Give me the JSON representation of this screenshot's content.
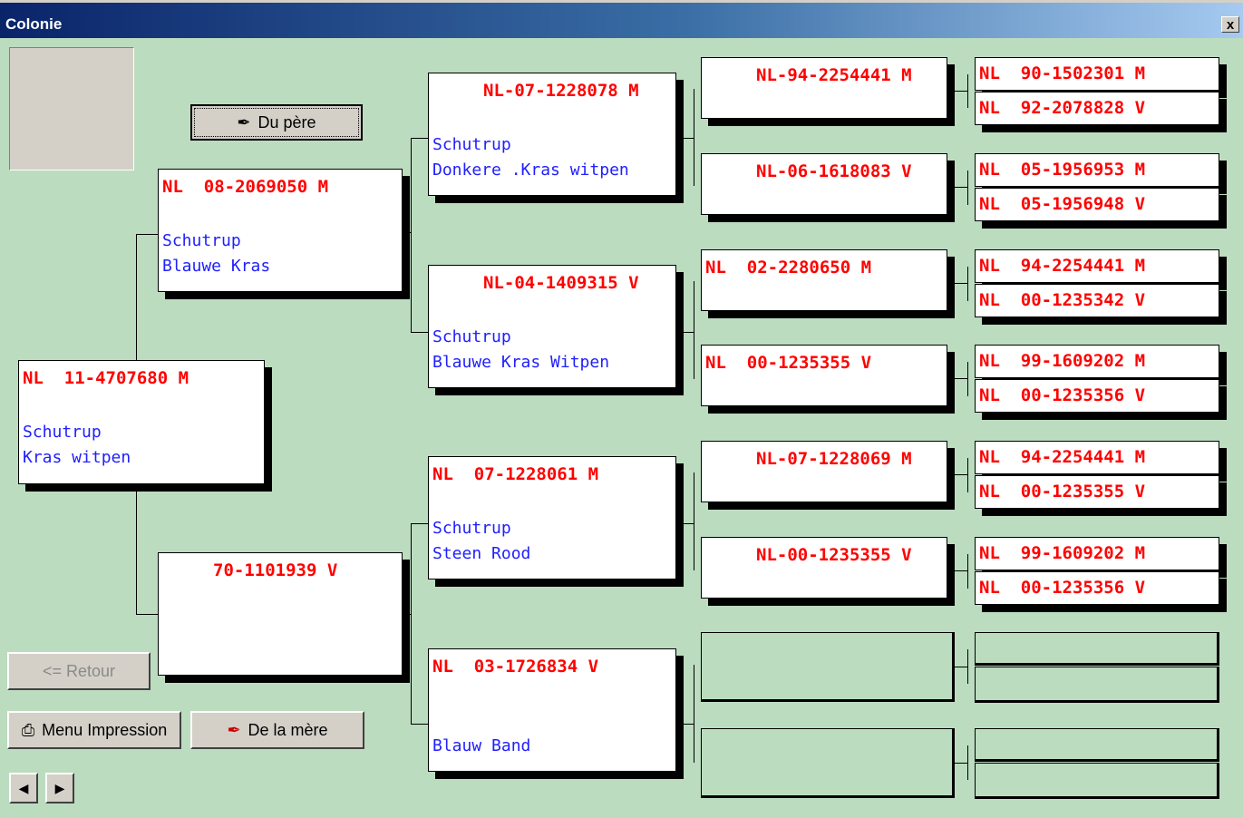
{
  "window": {
    "title": "Colonie",
    "close_label": "x"
  },
  "buttons": {
    "du_pere": "Du père",
    "retour": "<= Retour",
    "menu_impression": "Menu Impression",
    "de_la_mere": "De la mère",
    "prev": "◀",
    "next": "▶"
  },
  "subject": {
    "header": "NL  11-4707680 M",
    "line1": "Schutrup",
    "line2": "Kras witpen"
  },
  "father": {
    "header": "NL  08-2069050 M",
    "line1": "Schutrup",
    "line2": "Blauwe Kras"
  },
  "mother": {
    "header": "70-1101939 V",
    "line1": "",
    "line2": ""
  },
  "gp": [
    {
      "header": "NL-07-1228078 M",
      "line1": "Schutrup",
      "line2": "Donkere .Kras witpen"
    },
    {
      "header": "NL-04-1409315 V",
      "line1": "Schutrup",
      "line2": "Blauwe Kras Witpen"
    },
    {
      "header": "NL  07-1228061 M",
      "line1": "Schutrup",
      "line2": "Steen Rood"
    },
    {
      "header": "NL  03-1726834 V",
      "line1": "",
      "line2": "Blauw Band"
    }
  ],
  "ggp": [
    {
      "header": "NL-94-2254441 M"
    },
    {
      "header": "NL-06-1618083 V"
    },
    {
      "header": "NL  02-2280650 M"
    },
    {
      "header": "NL  00-1235355 V"
    },
    {
      "header": "NL-07-1228069 M"
    },
    {
      "header": "NL-00-1235355 V"
    },
    {
      "header": ""
    },
    {
      "header": ""
    }
  ],
  "gggp": [
    "NL  90-1502301 M",
    "NL  92-2078828 V",
    "NL  05-1956953 M",
    "NL  05-1956948 V",
    "NL  94-2254441 M",
    "NL  00-1235342 V",
    "NL  99-1609202 M",
    "NL  00-1235356 V",
    "NL  94-2254441 M",
    "NL  00-1235355 V",
    "NL  99-1609202 M",
    "NL  00-1235356 V",
    "",
    "",
    "",
    ""
  ]
}
